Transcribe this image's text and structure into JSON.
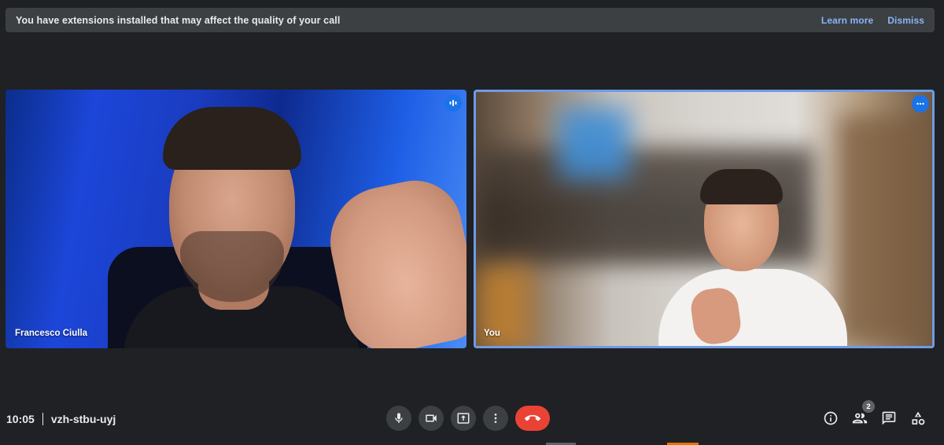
{
  "banner": {
    "message": "You have extensions installed that may affect the quality of your call",
    "learn_more": "Learn more",
    "dismiss": "Dismiss"
  },
  "tiles": [
    {
      "name": "Francesco Ciulla",
      "badge_icon": "audio-level-icon",
      "speaking": true
    },
    {
      "name": "You",
      "badge_icon": "more-options-icon",
      "active_border_color": "#6f9be3"
    }
  ],
  "meeting": {
    "time": "10:05",
    "code": "vzh-stbu-uyj"
  },
  "controls": {
    "mic_icon": "microphone-icon",
    "camera_icon": "camera-icon",
    "present_icon": "present-screen-icon",
    "more_icon": "more-vert-icon",
    "end_call_icon": "end-call-icon",
    "end_call_color": "#ea4335"
  },
  "right_controls": {
    "info_icon": "info-icon",
    "people_icon": "people-icon",
    "people_count": "2",
    "chat_icon": "chat-icon",
    "activities_icon": "activities-icon"
  },
  "colors": {
    "background": "#202124",
    "banner_bg": "#3c4043",
    "link": "#8ab4f8",
    "accent": "#1a73e8"
  }
}
